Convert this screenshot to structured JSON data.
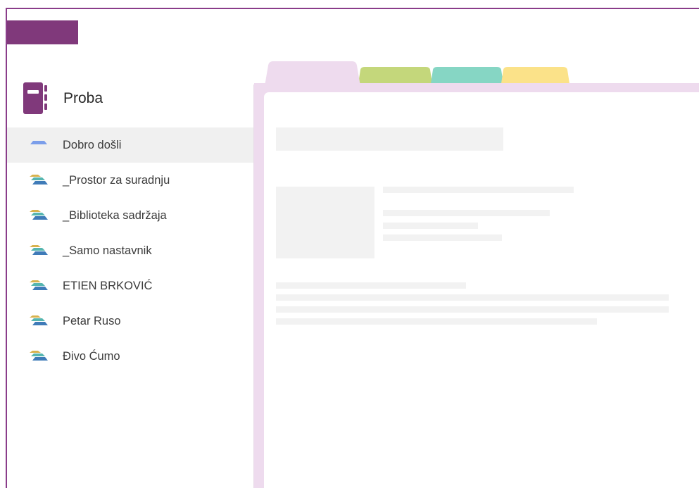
{
  "colors": {
    "brand": "#80397b",
    "page_tab": "#eedbee",
    "tab_green": "#c4d77b",
    "tab_teal": "#86d6c4",
    "tab_yellow": "#fbe289",
    "section_icon_front": "#3f7bb8",
    "section_icon_mid": "#56b6b0",
    "section_icon_back": "#d8b24e",
    "active_icon": "#7b9eea"
  },
  "notebook": {
    "title": "Proba",
    "icon": "notebook-icon"
  },
  "sections": [
    {
      "label": "Dobro došli",
      "active": true,
      "icon": "section-icon"
    },
    {
      "label": "_Prostor za suradnju",
      "active": false,
      "icon": "section-group-icon"
    },
    {
      "label": "_Biblioteka sadržaja",
      "active": false,
      "icon": "section-group-icon"
    },
    {
      "label": "_Samo nastavnik",
      "active": false,
      "icon": "section-group-icon"
    },
    {
      "label": "ETIEN BRKOVIĆ",
      "active": false,
      "icon": "section-group-icon"
    },
    {
      "label": "Petar Ruso",
      "active": false,
      "icon": "section-group-icon"
    },
    {
      "label": "Đivo Ćumo",
      "active": false,
      "icon": "section-group-icon"
    }
  ]
}
